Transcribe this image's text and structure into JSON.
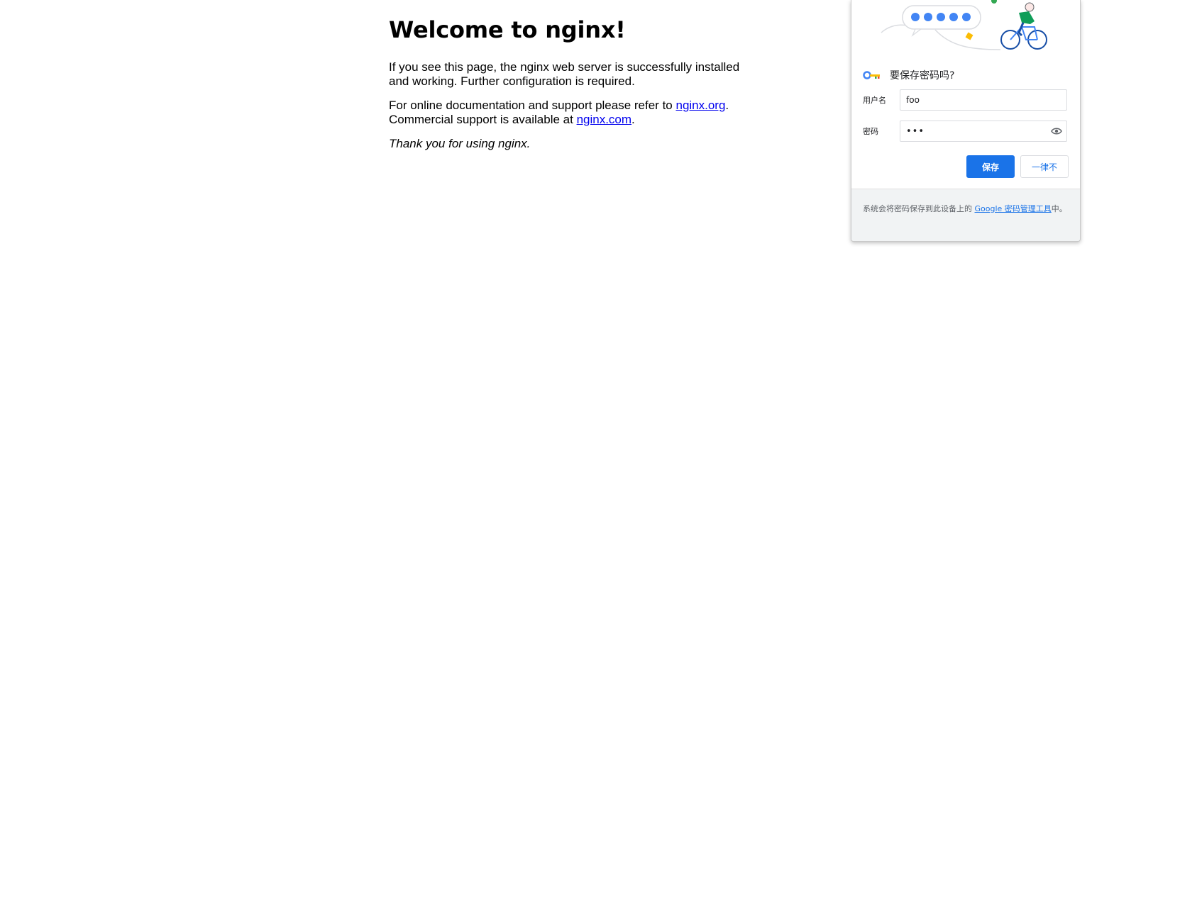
{
  "nginx": {
    "heading": "Welcome to nginx!",
    "para1": "If you see this page, the nginx web server is successfully installed and working. Further configuration is required.",
    "para2_prefix": "For online documentation and support please refer to ",
    "link_org": "nginx.org",
    "para2_mid": ".",
    "para2_line2": "Commercial support is available at ",
    "link_com": "nginx.com",
    "para2_end": ".",
    "para3": "Thank you for using nginx."
  },
  "save_password": {
    "title": "要保存密码吗?",
    "username_label": "用户名",
    "username_value": "foo",
    "password_label": "密码",
    "password_value": "•••",
    "save_button": "保存",
    "never_button": "一律不",
    "footer_prefix": "系统会将密码保存到此设备上的 ",
    "footer_link": "Google 密码管理工具",
    "footer_suffix": "中。",
    "accent_color": "#1a73e8"
  }
}
